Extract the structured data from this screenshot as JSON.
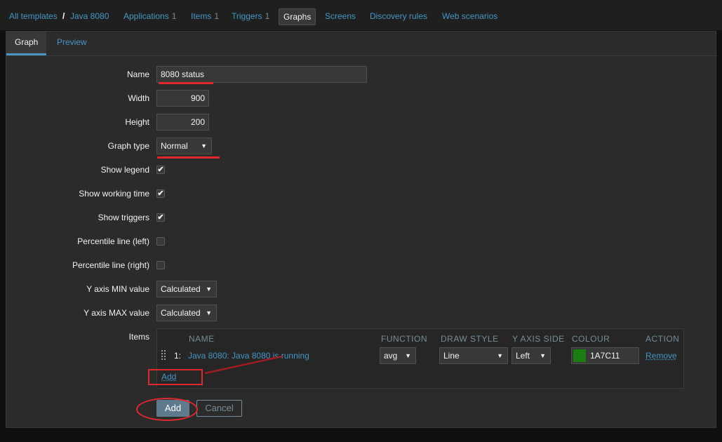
{
  "breadcrumb": {
    "root": "All templates",
    "separator": "/",
    "template": "Java 8080"
  },
  "nav_tabs": [
    {
      "label": "Applications",
      "count": "1"
    },
    {
      "label": "Items",
      "count": "1"
    },
    {
      "label": "Triggers",
      "count": "1"
    },
    {
      "label": "Graphs",
      "count": ""
    },
    {
      "label": "Screens",
      "count": ""
    },
    {
      "label": "Discovery rules",
      "count": ""
    },
    {
      "label": "Web scenarios",
      "count": ""
    }
  ],
  "subtabs": {
    "graph": "Graph",
    "preview": "Preview"
  },
  "form": {
    "name_label": "Name",
    "name_value": "8080 status",
    "width_label": "Width",
    "width_value": "900",
    "height_label": "Height",
    "height_value": "200",
    "graph_type_label": "Graph type",
    "graph_type_value": "Normal",
    "show_legend_label": "Show legend",
    "show_working_time_label": "Show working time",
    "show_triggers_label": "Show triggers",
    "percentile_left_label": "Percentile line (left)",
    "percentile_right_label": "Percentile line (right)",
    "ymin_label": "Y axis MIN value",
    "ymin_value": "Calculated",
    "ymax_label": "Y axis MAX value",
    "ymax_value": "Calculated",
    "items_label": "Items",
    "check_mark": "✔"
  },
  "items_table": {
    "headers": {
      "name": "NAME",
      "function": "FUNCTION",
      "draw_style": "DRAW STYLE",
      "y_axis_side": "Y AXIS SIDE",
      "colour": "COLOUR",
      "action": "ACTION"
    },
    "rows": [
      {
        "index": "1:",
        "name": "Java 8080: Java 8080 is running",
        "function": "avg",
        "draw_style": "Line",
        "y_axis_side": "Left",
        "colour": "1A7C11",
        "action": "Remove"
      }
    ],
    "add_link": "Add"
  },
  "buttons": {
    "add": "Add",
    "cancel": "Cancel"
  },
  "colors": {
    "accent": "#4796c4",
    "swatch": "#1a7c11",
    "annotation": "#e0282f"
  },
  "select_arrow": "▼"
}
